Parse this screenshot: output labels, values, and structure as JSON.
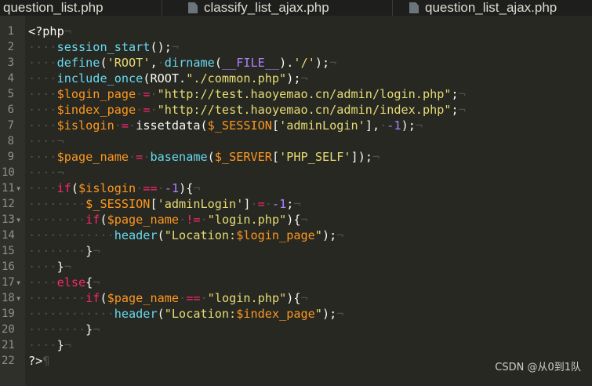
{
  "tabs": [
    {
      "label": "question_list.php"
    },
    {
      "label": "classify_list_ajax.php"
    },
    {
      "label": "question_list_ajax.php"
    }
  ],
  "watermark": "CSDN @从0到1队",
  "colors": {
    "background": "#272822",
    "keyword": "#f92672",
    "function": "#66d9ef",
    "string": "#e6db74",
    "number": "#ae81ff",
    "variable": "#fd971f"
  },
  "lines": [
    {
      "n": "1",
      "fold": "",
      "seg": [
        [
          "tag",
          "<?php"
        ],
        [
          "ws",
          "¬"
        ]
      ]
    },
    {
      "n": "2",
      "fold": "",
      "seg": [
        [
          "ws",
          "····"
        ],
        [
          "fn",
          "session_start"
        ],
        [
          "plain",
          "();"
        ],
        [
          "ws",
          "¬"
        ]
      ]
    },
    {
      "n": "3",
      "fold": "",
      "seg": [
        [
          "ws",
          "····"
        ],
        [
          "fn",
          "define"
        ],
        [
          "plain",
          "("
        ],
        [
          "str",
          "'ROOT'"
        ],
        [
          "plain",
          ","
        ],
        [
          "ws",
          "·"
        ],
        [
          "fn",
          "dirname"
        ],
        [
          "plain",
          "("
        ],
        [
          "const",
          "__FILE__"
        ],
        [
          "plain",
          ")."
        ],
        [
          "str",
          "'/'"
        ],
        [
          "plain",
          ");"
        ],
        [
          "ws",
          "¬"
        ]
      ]
    },
    {
      "n": "4",
      "fold": "",
      "seg": [
        [
          "ws",
          "····"
        ],
        [
          "fn",
          "include_once"
        ],
        [
          "plain",
          "(ROOT."
        ],
        [
          "str",
          "\"./common.php\""
        ],
        [
          "plain",
          ");"
        ],
        [
          "ws",
          "¬"
        ]
      ]
    },
    {
      "n": "5",
      "fold": "",
      "seg": [
        [
          "ws",
          "····"
        ],
        [
          "var",
          "$login_page"
        ],
        [
          "ws",
          "·"
        ],
        [
          "kw",
          "="
        ],
        [
          "ws",
          "·"
        ],
        [
          "str",
          "\"http://test.haoyemao.cn/admin/login.php\""
        ],
        [
          "plain",
          ";"
        ],
        [
          "ws",
          "¬"
        ]
      ]
    },
    {
      "n": "6",
      "fold": "",
      "seg": [
        [
          "ws",
          "····"
        ],
        [
          "var",
          "$index_page"
        ],
        [
          "ws",
          "·"
        ],
        [
          "kw",
          "="
        ],
        [
          "ws",
          "·"
        ],
        [
          "str",
          "\"http://test.haoyemao.cn/admin/index.php\""
        ],
        [
          "plain",
          ";"
        ],
        [
          "ws",
          "¬"
        ]
      ]
    },
    {
      "n": "7",
      "fold": "",
      "seg": [
        [
          "ws",
          "····"
        ],
        [
          "var",
          "$islogin"
        ],
        [
          "ws",
          "·"
        ],
        [
          "kw",
          "="
        ],
        [
          "ws",
          "·"
        ],
        [
          "plain",
          "issetdata("
        ],
        [
          "var",
          "$_SESSION"
        ],
        [
          "plain",
          "["
        ],
        [
          "str",
          "'adminLogin'"
        ],
        [
          "plain",
          "],"
        ],
        [
          "ws",
          "·"
        ],
        [
          "num",
          "-1"
        ],
        [
          "plain",
          ");"
        ],
        [
          "ws",
          "¬"
        ]
      ]
    },
    {
      "n": "8",
      "fold": "",
      "seg": [
        [
          "ws",
          "····¬"
        ]
      ]
    },
    {
      "n": "9",
      "fold": "",
      "seg": [
        [
          "ws",
          "····"
        ],
        [
          "var",
          "$page_name"
        ],
        [
          "ws",
          "·"
        ],
        [
          "kw",
          "="
        ],
        [
          "ws",
          "·"
        ],
        [
          "fn",
          "basename"
        ],
        [
          "plain",
          "("
        ],
        [
          "var",
          "$_SERVER"
        ],
        [
          "plain",
          "["
        ],
        [
          "str",
          "'PHP_SELF'"
        ],
        [
          "plain",
          "]);"
        ],
        [
          "ws",
          "¬"
        ]
      ]
    },
    {
      "n": "10",
      "fold": "",
      "seg": [
        [
          "ws",
          "····¬"
        ]
      ]
    },
    {
      "n": "11",
      "fold": "▾",
      "seg": [
        [
          "ws",
          "····"
        ],
        [
          "kw",
          "if"
        ],
        [
          "plain",
          "("
        ],
        [
          "var",
          "$islogin"
        ],
        [
          "ws",
          "·"
        ],
        [
          "kw",
          "=="
        ],
        [
          "ws",
          "·"
        ],
        [
          "num",
          "-1"
        ],
        [
          "plain",
          "){"
        ],
        [
          "ws",
          "¬"
        ]
      ]
    },
    {
      "n": "12",
      "fold": "",
      "seg": [
        [
          "ws",
          "········"
        ],
        [
          "var",
          "$_SESSION"
        ],
        [
          "plain",
          "["
        ],
        [
          "str",
          "'adminLogin'"
        ],
        [
          "plain",
          "]"
        ],
        [
          "ws",
          "·"
        ],
        [
          "kw",
          "="
        ],
        [
          "ws",
          "·"
        ],
        [
          "num",
          "-1"
        ],
        [
          "plain",
          ";"
        ],
        [
          "ws",
          "¬"
        ]
      ]
    },
    {
      "n": "13",
      "fold": "▾",
      "seg": [
        [
          "ws",
          "········"
        ],
        [
          "kw",
          "if"
        ],
        [
          "plain",
          "("
        ],
        [
          "var",
          "$page_name"
        ],
        [
          "ws",
          "·"
        ],
        [
          "kw",
          "!="
        ],
        [
          "ws",
          "·"
        ],
        [
          "str",
          "\"login.php\""
        ],
        [
          "plain",
          "){"
        ],
        [
          "ws",
          "¬"
        ]
      ]
    },
    {
      "n": "14",
      "fold": "",
      "seg": [
        [
          "ws",
          "············"
        ],
        [
          "fn",
          "header"
        ],
        [
          "plain",
          "("
        ],
        [
          "str",
          "\"Location:"
        ],
        [
          "var",
          "$login_page"
        ],
        [
          "str",
          "\""
        ],
        [
          "plain",
          ");"
        ],
        [
          "ws",
          "¬"
        ]
      ]
    },
    {
      "n": "15",
      "fold": "",
      "seg": [
        [
          "ws",
          "········"
        ],
        [
          "plain",
          "}"
        ],
        [
          "ws",
          "¬"
        ]
      ]
    },
    {
      "n": "16",
      "fold": "",
      "seg": [
        [
          "ws",
          "····"
        ],
        [
          "plain",
          "}"
        ],
        [
          "ws",
          "¬"
        ]
      ]
    },
    {
      "n": "17",
      "fold": "▾",
      "seg": [
        [
          "ws",
          "····"
        ],
        [
          "kw",
          "else"
        ],
        [
          "plain",
          "{"
        ],
        [
          "ws",
          "¬"
        ]
      ]
    },
    {
      "n": "18",
      "fold": "▾",
      "seg": [
        [
          "ws",
          "········"
        ],
        [
          "kw",
          "if"
        ],
        [
          "plain",
          "("
        ],
        [
          "var",
          "$page_name"
        ],
        [
          "ws",
          "·"
        ],
        [
          "kw",
          "=="
        ],
        [
          "ws",
          "·"
        ],
        [
          "str",
          "\"login.php\""
        ],
        [
          "plain",
          "){"
        ],
        [
          "ws",
          "¬"
        ]
      ]
    },
    {
      "n": "19",
      "fold": "",
      "seg": [
        [
          "ws",
          "············"
        ],
        [
          "fn",
          "header"
        ],
        [
          "plain",
          "("
        ],
        [
          "str",
          "\"Location:"
        ],
        [
          "var",
          "$index_page"
        ],
        [
          "str",
          "\""
        ],
        [
          "plain",
          ");"
        ],
        [
          "ws",
          "¬"
        ]
      ]
    },
    {
      "n": "20",
      "fold": "",
      "seg": [
        [
          "ws",
          "········"
        ],
        [
          "plain",
          "}"
        ],
        [
          "ws",
          "¬"
        ]
      ]
    },
    {
      "n": "21",
      "fold": "",
      "seg": [
        [
          "ws",
          "····"
        ],
        [
          "plain",
          "}"
        ],
        [
          "ws",
          "¬"
        ]
      ]
    },
    {
      "n": "22",
      "fold": "",
      "seg": [
        [
          "tag",
          "?>"
        ],
        [
          "ws",
          "¶"
        ]
      ]
    }
  ]
}
